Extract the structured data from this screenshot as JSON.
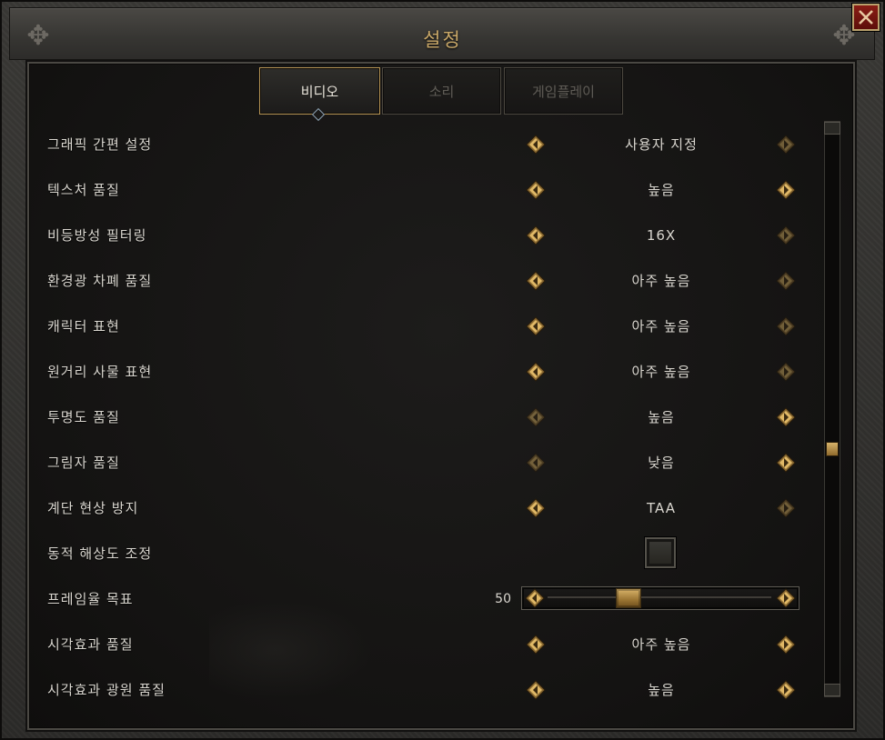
{
  "window": {
    "title": "설정"
  },
  "tabs": [
    {
      "label": "비디오",
      "active": true
    },
    {
      "label": "소리",
      "active": false
    },
    {
      "label": "게임플레이",
      "active": false
    }
  ],
  "settings": [
    {
      "label": "그래픽 간편 설정",
      "type": "selector",
      "value": "사용자 지정",
      "left_enabled": true,
      "right_enabled": false
    },
    {
      "label": "텍스처 품질",
      "type": "selector",
      "value": "높음",
      "left_enabled": true,
      "right_enabled": true
    },
    {
      "label": "비등방성 필터링",
      "type": "selector",
      "value": "16X",
      "left_enabled": true,
      "right_enabled": false
    },
    {
      "label": "환경광 차폐 품질",
      "type": "selector",
      "value": "아주 높음",
      "left_enabled": true,
      "right_enabled": false
    },
    {
      "label": "캐릭터 표현",
      "type": "selector",
      "value": "아주 높음",
      "left_enabled": true,
      "right_enabled": false
    },
    {
      "label": "원거리 사물 표현",
      "type": "selector",
      "value": "아주 높음",
      "left_enabled": true,
      "right_enabled": false
    },
    {
      "label": "투명도 품질",
      "type": "selector",
      "value": "높음",
      "left_enabled": false,
      "right_enabled": true
    },
    {
      "label": "그림자 품질",
      "type": "selector",
      "value": "낮음",
      "left_enabled": false,
      "right_enabled": true
    },
    {
      "label": "계단 현상 방지",
      "type": "selector",
      "value": "TAA",
      "left_enabled": true,
      "right_enabled": false
    },
    {
      "label": "동적 해상도 조정",
      "type": "checkbox",
      "checked": false
    },
    {
      "label": "프레임율 목표",
      "type": "slider",
      "value": "50",
      "fraction": 0.36
    },
    {
      "label": "시각효과 품질",
      "type": "selector",
      "value": "아주 높음",
      "left_enabled": true,
      "right_enabled": true
    },
    {
      "label": "시각효과 광원 품질",
      "type": "selector",
      "value": "높음",
      "left_enabled": true,
      "right_enabled": true
    }
  ],
  "scrollbar": {
    "position_fraction": 0.58
  },
  "colors": {
    "accent_gold": "#c9a868",
    "text": "#d9d6cf",
    "close_red": "#8a1d15"
  },
  "icons": {
    "left_arrow": "diamond-left-arrow-icon",
    "right_arrow": "diamond-right-arrow-icon",
    "close": "close-x-icon"
  }
}
